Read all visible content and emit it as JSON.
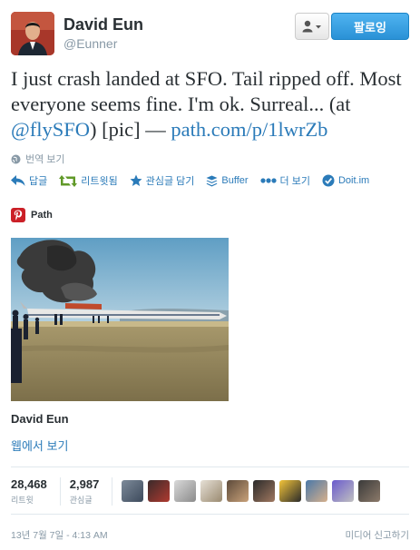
{
  "header": {
    "full_name": "David Eun",
    "screen_name": "@Eunner",
    "follow_label": "팔로잉"
  },
  "tweet": {
    "text_main": "I just crash landed at SFO. Tail ripped off. Most everyone seems fine. I'm ok. Surreal... (at ",
    "mention": "@flySFO",
    "text_mid": ") [pic] — ",
    "link": "path.com/p/1lwrZb"
  },
  "translate_label": "번역 보기",
  "actions": {
    "reply": "답글",
    "retweet": "리트윗됨",
    "favorite": "관심글 담기",
    "buffer": "Buffer",
    "more": "더 보기",
    "doit": "Doit.im"
  },
  "card": {
    "source": "Path",
    "author": "David Eun",
    "view_on_web": "웹에서 보기"
  },
  "stats": {
    "retweets": "28,468",
    "retweets_label": "리트윗",
    "favorites": "2,987",
    "favorites_label": "관심글"
  },
  "footer": {
    "timestamp": "13년 7월 7일 - 4:13 AM",
    "report": "미디어 신고하기"
  },
  "colors": {
    "link": "#2b7bb9",
    "follow_button": "#2a91d6",
    "muted": "#8899a6"
  }
}
